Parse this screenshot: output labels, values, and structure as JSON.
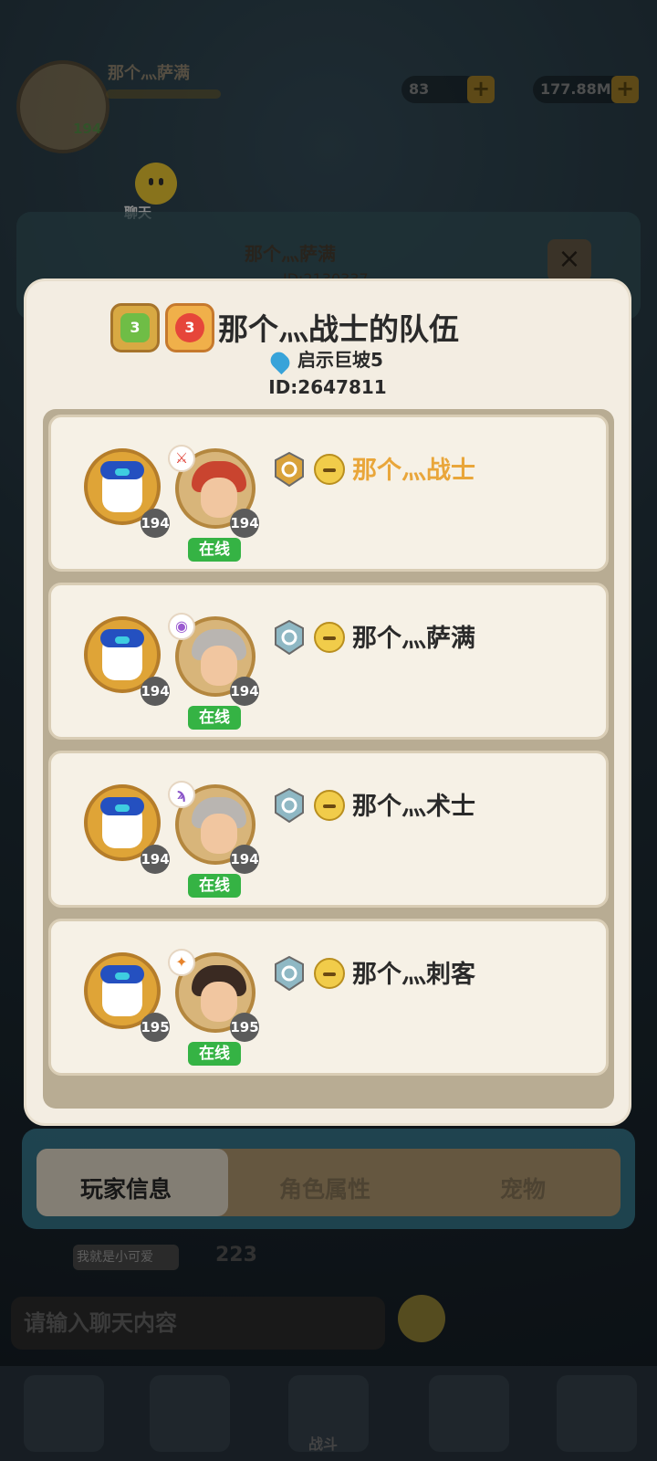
{
  "background_hud": {
    "player_name": "那个灬萨满",
    "level": "194",
    "stat1": "83",
    "stat2": "177.88M",
    "plus": "+",
    "chat_label": "聊天",
    "under_name": "那个灬萨满",
    "under_id": "ID:2130337",
    "close": "×"
  },
  "modal": {
    "title": "那个灬战士的队伍",
    "badge1": "3",
    "badge2": "3",
    "location": "启示巨坡5",
    "team_id": "ID:2647811"
  },
  "members": [
    {
      "name": "那个灬战士",
      "pet_level": "194",
      "hero_level": "194",
      "status": "在线",
      "class_icon": "warrior-icon",
      "class_glyph": "⚔",
      "rank": "gold",
      "leader": true,
      "hair": "#c9442f"
    },
    {
      "name": "那个灬萨满",
      "pet_level": "194",
      "hero_level": "194",
      "status": "在线",
      "class_icon": "shaman-icon",
      "class_glyph": "◉",
      "rank": "silver",
      "leader": false,
      "hair": "#b9b5b1"
    },
    {
      "name": "那个灬术士",
      "pet_level": "194",
      "hero_level": "194",
      "status": "在线",
      "class_icon": "warlock-icon",
      "class_glyph": "ϡ",
      "rank": "silver",
      "leader": false,
      "hair": "#b9b5b1"
    },
    {
      "name": "那个灬刺客",
      "pet_level": "195",
      "hero_level": "195",
      "status": "在线",
      "class_icon": "assassin-icon",
      "class_glyph": "✦",
      "rank": "silver",
      "leader": false,
      "hair": "#3a2a22"
    }
  ],
  "bottom": {
    "tab1": "玩家信息",
    "tab2": "角色属性",
    "tab3": "宠物",
    "chat_user": "我就是小可爱",
    "chat_count": "223",
    "chat_placeholder": "请输入聊天内容",
    "nav_center": "战斗"
  },
  "colors": {
    "leader_name": "#e9a63a",
    "online": "#35b344",
    "gold_rank": "#d9a23a",
    "silver_rank": "#8fb8c4"
  }
}
